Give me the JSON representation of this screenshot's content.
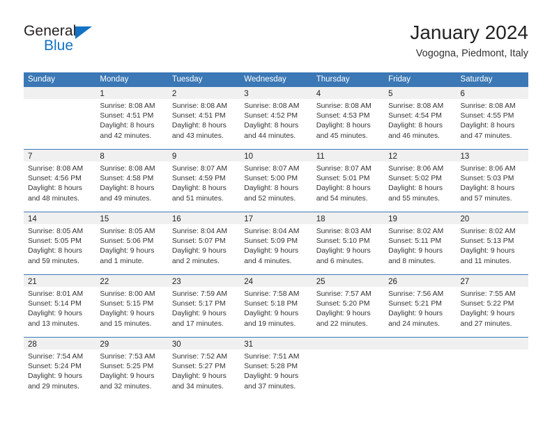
{
  "brand": {
    "name_part1": "General",
    "name_part2": "Blue"
  },
  "header": {
    "title": "January 2024",
    "subtitle": "Vogogna, Piedmont, Italy"
  },
  "weekdays": [
    "Sunday",
    "Monday",
    "Tuesday",
    "Wednesday",
    "Thursday",
    "Friday",
    "Saturday"
  ],
  "colors": {
    "header_bar": "#3b78b5",
    "brand_blue": "#1272c4",
    "day_strip": "#f0f0f0",
    "text": "#333333"
  },
  "weeks": [
    [
      {
        "day": "",
        "lines": []
      },
      {
        "day": "1",
        "lines": [
          "Sunrise: 8:08 AM",
          "Sunset: 4:51 PM",
          "Daylight: 8 hours",
          "and 42 minutes."
        ]
      },
      {
        "day": "2",
        "lines": [
          "Sunrise: 8:08 AM",
          "Sunset: 4:51 PM",
          "Daylight: 8 hours",
          "and 43 minutes."
        ]
      },
      {
        "day": "3",
        "lines": [
          "Sunrise: 8:08 AM",
          "Sunset: 4:52 PM",
          "Daylight: 8 hours",
          "and 44 minutes."
        ]
      },
      {
        "day": "4",
        "lines": [
          "Sunrise: 8:08 AM",
          "Sunset: 4:53 PM",
          "Daylight: 8 hours",
          "and 45 minutes."
        ]
      },
      {
        "day": "5",
        "lines": [
          "Sunrise: 8:08 AM",
          "Sunset: 4:54 PM",
          "Daylight: 8 hours",
          "and 46 minutes."
        ]
      },
      {
        "day": "6",
        "lines": [
          "Sunrise: 8:08 AM",
          "Sunset: 4:55 PM",
          "Daylight: 8 hours",
          "and 47 minutes."
        ]
      }
    ],
    [
      {
        "day": "7",
        "lines": [
          "Sunrise: 8:08 AM",
          "Sunset: 4:56 PM",
          "Daylight: 8 hours",
          "and 48 minutes."
        ]
      },
      {
        "day": "8",
        "lines": [
          "Sunrise: 8:08 AM",
          "Sunset: 4:58 PM",
          "Daylight: 8 hours",
          "and 49 minutes."
        ]
      },
      {
        "day": "9",
        "lines": [
          "Sunrise: 8:07 AM",
          "Sunset: 4:59 PM",
          "Daylight: 8 hours",
          "and 51 minutes."
        ]
      },
      {
        "day": "10",
        "lines": [
          "Sunrise: 8:07 AM",
          "Sunset: 5:00 PM",
          "Daylight: 8 hours",
          "and 52 minutes."
        ]
      },
      {
        "day": "11",
        "lines": [
          "Sunrise: 8:07 AM",
          "Sunset: 5:01 PM",
          "Daylight: 8 hours",
          "and 54 minutes."
        ]
      },
      {
        "day": "12",
        "lines": [
          "Sunrise: 8:06 AM",
          "Sunset: 5:02 PM",
          "Daylight: 8 hours",
          "and 55 minutes."
        ]
      },
      {
        "day": "13",
        "lines": [
          "Sunrise: 8:06 AM",
          "Sunset: 5:03 PM",
          "Daylight: 8 hours",
          "and 57 minutes."
        ]
      }
    ],
    [
      {
        "day": "14",
        "lines": [
          "Sunrise: 8:05 AM",
          "Sunset: 5:05 PM",
          "Daylight: 8 hours",
          "and 59 minutes."
        ]
      },
      {
        "day": "15",
        "lines": [
          "Sunrise: 8:05 AM",
          "Sunset: 5:06 PM",
          "Daylight: 9 hours",
          "and 1 minute."
        ]
      },
      {
        "day": "16",
        "lines": [
          "Sunrise: 8:04 AM",
          "Sunset: 5:07 PM",
          "Daylight: 9 hours",
          "and 2 minutes."
        ]
      },
      {
        "day": "17",
        "lines": [
          "Sunrise: 8:04 AM",
          "Sunset: 5:09 PM",
          "Daylight: 9 hours",
          "and 4 minutes."
        ]
      },
      {
        "day": "18",
        "lines": [
          "Sunrise: 8:03 AM",
          "Sunset: 5:10 PM",
          "Daylight: 9 hours",
          "and 6 minutes."
        ]
      },
      {
        "day": "19",
        "lines": [
          "Sunrise: 8:02 AM",
          "Sunset: 5:11 PM",
          "Daylight: 9 hours",
          "and 8 minutes."
        ]
      },
      {
        "day": "20",
        "lines": [
          "Sunrise: 8:02 AM",
          "Sunset: 5:13 PM",
          "Daylight: 9 hours",
          "and 11 minutes."
        ]
      }
    ],
    [
      {
        "day": "21",
        "lines": [
          "Sunrise: 8:01 AM",
          "Sunset: 5:14 PM",
          "Daylight: 9 hours",
          "and 13 minutes."
        ]
      },
      {
        "day": "22",
        "lines": [
          "Sunrise: 8:00 AM",
          "Sunset: 5:15 PM",
          "Daylight: 9 hours",
          "and 15 minutes."
        ]
      },
      {
        "day": "23",
        "lines": [
          "Sunrise: 7:59 AM",
          "Sunset: 5:17 PM",
          "Daylight: 9 hours",
          "and 17 minutes."
        ]
      },
      {
        "day": "24",
        "lines": [
          "Sunrise: 7:58 AM",
          "Sunset: 5:18 PM",
          "Daylight: 9 hours",
          "and 19 minutes."
        ]
      },
      {
        "day": "25",
        "lines": [
          "Sunrise: 7:57 AM",
          "Sunset: 5:20 PM",
          "Daylight: 9 hours",
          "and 22 minutes."
        ]
      },
      {
        "day": "26",
        "lines": [
          "Sunrise: 7:56 AM",
          "Sunset: 5:21 PM",
          "Daylight: 9 hours",
          "and 24 minutes."
        ]
      },
      {
        "day": "27",
        "lines": [
          "Sunrise: 7:55 AM",
          "Sunset: 5:22 PM",
          "Daylight: 9 hours",
          "and 27 minutes."
        ]
      }
    ],
    [
      {
        "day": "28",
        "lines": [
          "Sunrise: 7:54 AM",
          "Sunset: 5:24 PM",
          "Daylight: 9 hours",
          "and 29 minutes."
        ]
      },
      {
        "day": "29",
        "lines": [
          "Sunrise: 7:53 AM",
          "Sunset: 5:25 PM",
          "Daylight: 9 hours",
          "and 32 minutes."
        ]
      },
      {
        "day": "30",
        "lines": [
          "Sunrise: 7:52 AM",
          "Sunset: 5:27 PM",
          "Daylight: 9 hours",
          "and 34 minutes."
        ]
      },
      {
        "day": "31",
        "lines": [
          "Sunrise: 7:51 AM",
          "Sunset: 5:28 PM",
          "Daylight: 9 hours",
          "and 37 minutes."
        ]
      },
      {
        "day": "",
        "lines": []
      },
      {
        "day": "",
        "lines": []
      },
      {
        "day": "",
        "lines": []
      }
    ]
  ]
}
